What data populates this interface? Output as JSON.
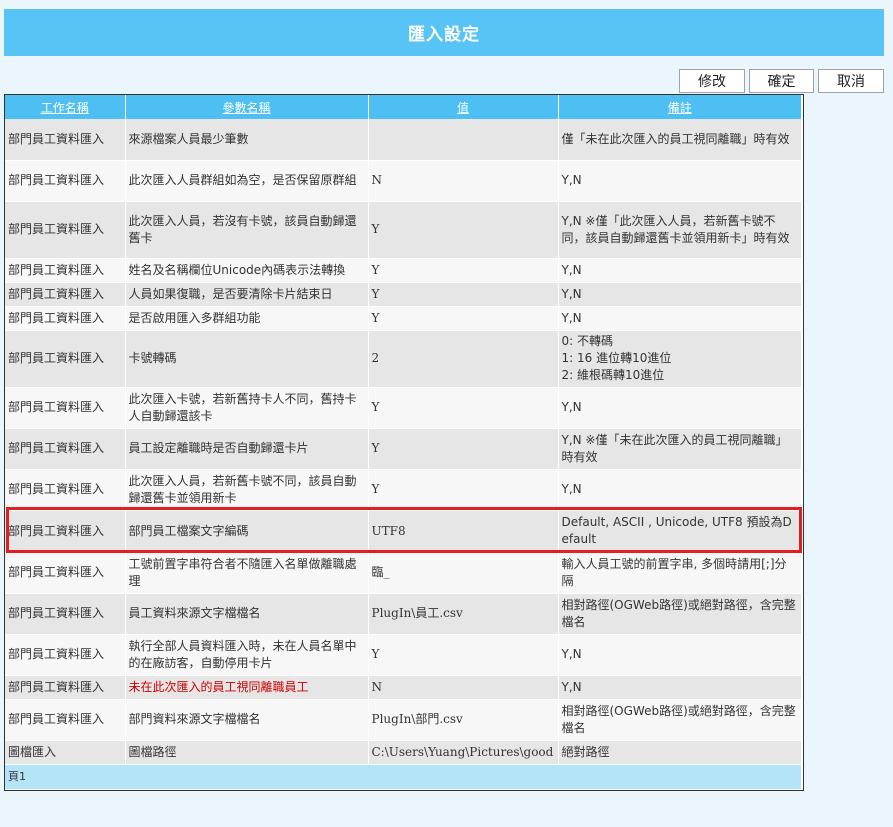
{
  "header": {
    "title": "匯入設定"
  },
  "toolbar": {
    "modify": "修改",
    "confirm": "確定",
    "cancel": "取消"
  },
  "table": {
    "columns": [
      "工作名稱",
      "參數名稱",
      "值",
      "備註"
    ],
    "rows": [
      {
        "task": "部門員工資料匯入",
        "param": "來源檔案人員最少筆數",
        "value": "",
        "note": [
          "僅「未在此次匯入的員工視同離職」時有效"
        ]
      },
      {
        "task": "部門員工資料匯入",
        "param": "此次匯入人員群組如為空，是否保留原群組",
        "value": "N",
        "note": [
          "Y,N"
        ]
      },
      {
        "task": "部門員工資料匯入",
        "param": "此次匯入人員，若沒有卡號，該員自動歸還舊卡",
        "value": "Y",
        "note": [
          "Y,N ※僅「此次匯入人員，若新舊卡號不同，該員自動歸還舊卡並領用新卡」時有效"
        ]
      },
      {
        "task": "部門員工資料匯入",
        "param": "姓名及名稱欄位Unicode內碼表示法轉換",
        "value": "Y",
        "note": [
          "Y,N"
        ]
      },
      {
        "task": "部門員工資料匯入",
        "param": "人員如果復職，是否要清除卡片結束日",
        "value": "Y",
        "note": [
          "Y,N"
        ]
      },
      {
        "task": "部門員工資料匯入",
        "param": "是否啟用匯入多群組功能",
        "value": "Y",
        "note": [
          "Y,N"
        ]
      },
      {
        "task": "部門員工資料匯入",
        "param": "卡號轉碼",
        "value": "2",
        "note": [
          "0: 不轉碼",
          "1: 16 進位轉10進位",
          "2: 維根碼轉10進位"
        ]
      },
      {
        "task": "部門員工資料匯入",
        "param": "此次匯入卡號，若新舊持卡人不同，舊持卡人自動歸還該卡",
        "value": "Y",
        "note": [
          "Y,N"
        ]
      },
      {
        "task": "部門員工資料匯入",
        "param": "員工設定離職時是否自動歸還卡片",
        "value": "Y",
        "note": [
          "Y,N ※僅「未在此次匯入的員工視同離職」時有效"
        ]
      },
      {
        "task": "部門員工資料匯入",
        "param": "此次匯入人員，若新舊卡號不同，該員自動歸還舊卡並領用新卡",
        "value": "Y",
        "note": [
          "Y,N"
        ]
      },
      {
        "task": "部門員工資料匯入",
        "param": "部門員工檔案文字編碼",
        "value": "UTF8",
        "note": [
          "Default, ASCII , Unicode, UTF8 預設為Default"
        ]
      },
      {
        "task": "部門員工資料匯入",
        "param": "工號前置字串符合者不隨匯入名單做離職處理",
        "value": "臨_",
        "note": [
          "輸入人員工號的前置字串, 多個時請用[;]分隔"
        ]
      },
      {
        "task": "部門員工資料匯入",
        "param": "員工資料來源文字檔檔名",
        "value": "PlugIn\\員工.csv",
        "note": [
          "相對路徑(OGWeb路徑)或絕對路徑，含完整檔名"
        ]
      },
      {
        "task": "部門員工資料匯入",
        "param": "執行全部人員資料匯入時，未在人員名單中的在廠訪客，自動停用卡片",
        "value": "Y",
        "note": [
          "Y,N"
        ]
      },
      {
        "task": "部門員工資料匯入",
        "param": "未在此次匯入的員工視同離職員工",
        "value": "N",
        "note": [
          "Y,N"
        ]
      },
      {
        "task": "部門員工資料匯入",
        "param": "部門資料來源文字檔檔名",
        "value": "PlugIn\\部門.csv",
        "note": [
          "相對路徑(OGWeb路徑)或絕對路徑，含完整檔名"
        ]
      },
      {
        "task": "圖檔匯入",
        "param": "圖檔路徑",
        "value": "C:\\Users\\Yuang\\Pictures\\good",
        "note": [
          "絕對路徑"
        ]
      }
    ],
    "footer": "頁1"
  },
  "colors": {
    "header_bg": "#57c4f5",
    "table_header_bg": "#4ebff2",
    "highlight_border": "#e02020",
    "warning_text": "#cc0000"
  },
  "highlighted_row_index": 10,
  "red_param_row_index": 14
}
